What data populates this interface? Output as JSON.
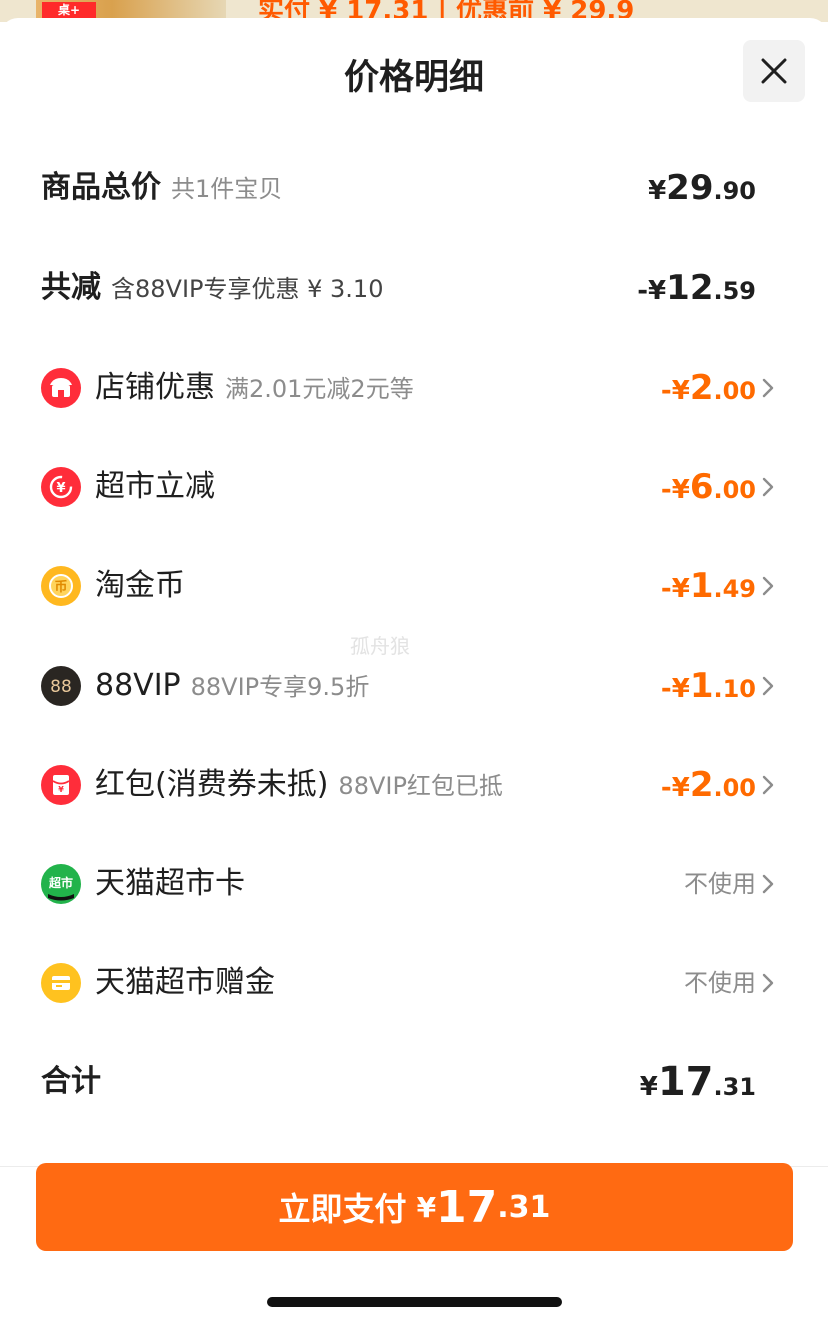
{
  "background": {
    "tag": "桌+",
    "text": "实付 ¥ 17.31 | 优惠前 ¥ 29.9"
  },
  "header": {
    "title": "价格明细",
    "close_icon": "close-icon"
  },
  "summary": {
    "label": "商品总价",
    "sub": "共1件宝贝",
    "yen": "¥",
    "int": "29",
    "dec": ".90"
  },
  "reduction": {
    "label": "共减",
    "sub": "含88VIP专享优惠 ¥ 3.10",
    "prefix": "-¥",
    "int": "12",
    "dec": ".59"
  },
  "items": [
    {
      "icon": "shop-icon",
      "label": "店铺优惠",
      "sub": "满2.01元减2元等",
      "prefix": "-¥",
      "int": "2",
      "dec": ".00"
    },
    {
      "icon": "supermarket-discount-icon",
      "label": "超市立减",
      "sub": "",
      "prefix": "-¥",
      "int": "6",
      "dec": ".00"
    },
    {
      "icon": "coin-icon",
      "label": "淘金币",
      "sub": "",
      "prefix": "-¥",
      "int": "1",
      "dec": ".49"
    },
    {
      "icon": "vip-88-icon",
      "label": "88VIP",
      "sub": "88VIP专享9.5折",
      "prefix": "-¥",
      "int": "1",
      "dec": ".10"
    },
    {
      "icon": "red-packet-icon",
      "label": "红包(消费券未抵)",
      "sub": "88VIP红包已抵",
      "prefix": "-¥",
      "int": "2",
      "dec": ".00"
    },
    {
      "icon": "tmall-card-icon",
      "label": "天猫超市卡",
      "status": "不使用"
    },
    {
      "icon": "gift-money-icon",
      "label": "天猫超市赠金",
      "status": "不使用"
    }
  ],
  "total": {
    "label": "合计",
    "yen": "¥",
    "int": "17",
    "dec": ".31"
  },
  "watermark": "孤舟狼",
  "pay_button": {
    "label": "立即支付",
    "yen": "¥",
    "int": "17",
    "dec": ".31"
  },
  "colors": {
    "accent": "#ff6a12",
    "discount": "#ff6a00",
    "muted": "#8c8c8c"
  }
}
